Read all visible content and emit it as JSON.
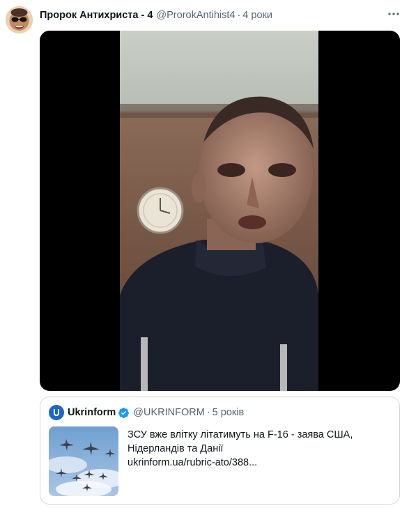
{
  "tweet": {
    "display_name": "Пророк Антихриста - 4",
    "handle": "@ProrokAntihist4",
    "separator": "·",
    "time": "4 роки"
  },
  "quoted": {
    "display_name": "Ukrinform",
    "handle": "@UKRINFORM",
    "separator": "·",
    "time": "5 років",
    "text": "ЗСУ вже влітку літатимуть на F-16 - заява США, Нідерландів та Данії",
    "link": "ukrinform.ua/rubric-ato/388..."
  },
  "icons": {
    "more": "more-horizontal-icon",
    "verified": "verified-badge-icon",
    "logo": "ukrinform-logo-icon"
  },
  "colors": {
    "text": "#0f1419",
    "secondary": "#536471",
    "border": "#cfd9de",
    "verified": "#1d9bf0",
    "ukrinform_blue": "#1a66c9"
  }
}
